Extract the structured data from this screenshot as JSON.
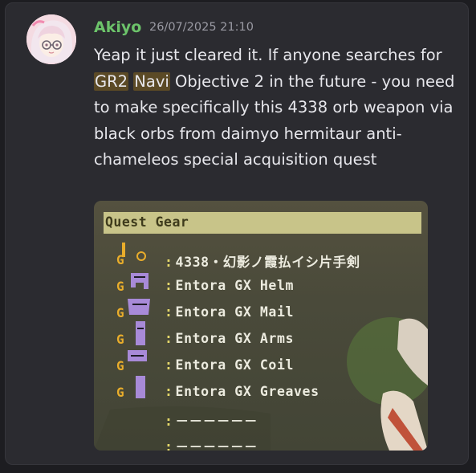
{
  "message": {
    "author": "Akiyo",
    "timestamp": "26/07/2025 21:10",
    "text_before": "Yeap it just cleared it. If anyone searches for ",
    "tag1": "GR2",
    "tag2": "Navi",
    "text_after": " Objective 2 in the future - you need to make specifically this 4338 orb weapon via black orbs from daimyo hermitaur anti-chameleos special acquisition quest"
  },
  "attachment": {
    "header": "Quest Gear",
    "items": [
      "4338・幻影ノ霞払イシ片手剣",
      "Entora GX Helm",
      "Entora GX Mail",
      "Entora GX Arms",
      "Entora GX Coil",
      "Entora GX Greaves",
      "－－－－－－",
      "－－－－－－"
    ]
  }
}
